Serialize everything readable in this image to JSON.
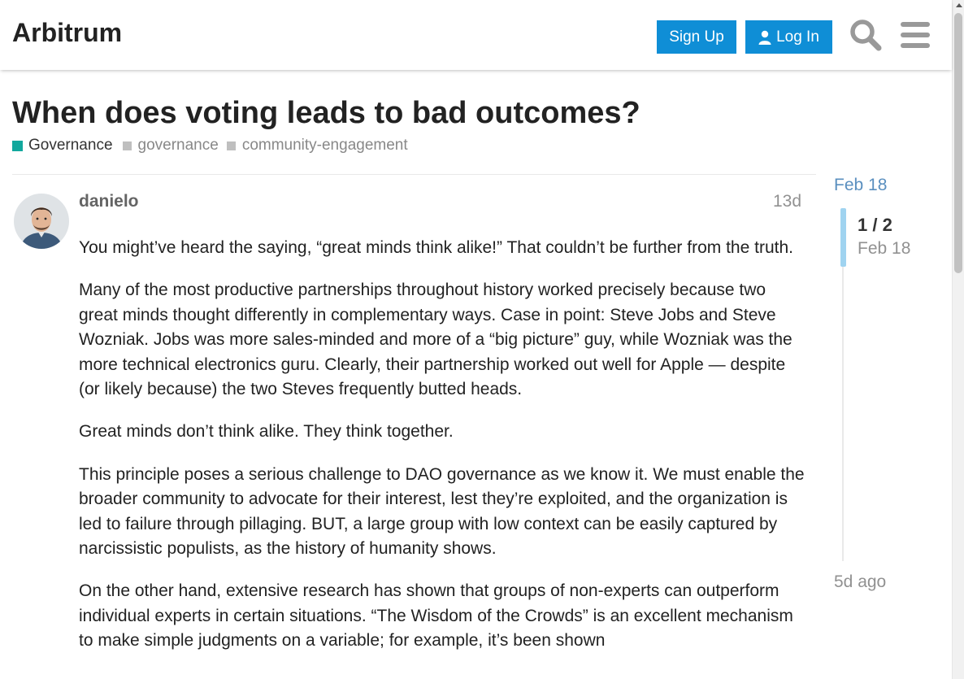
{
  "header": {
    "site_title": "Arbitrum",
    "signup_label": "Sign Up",
    "login_label": "Log In"
  },
  "topic": {
    "title": "When does voting leads to bad outcomes?",
    "category": "Governance",
    "tags": [
      "governance",
      "community-engagement"
    ]
  },
  "post": {
    "username": "danielo",
    "age": "13d",
    "paragraphs": [
      "You might’ve heard the saying, “great minds think alike!” That couldn’t be further from the truth.",
      "Many of the most productive partnerships throughout history worked precisely because two great minds thought differently in complementary ways. Case in point: Steve Jobs and Steve Wozniak. Jobs was more sales-minded and more of a “big picture” guy, while Wozniak was the more technical electronics guru. Clearly, their partnership worked out well for Apple — despite (or likely because) the two Steves frequently butted heads.",
      "Great minds don’t think alike. They think together.",
      "This principle poses a serious challenge to DAO governance as we know it. We must enable the broader community to advocate for their interest, lest they’re exploited, and the organization is led to failure through pillaging. BUT, a large group with low context can be easily captured by narcissistic populists, as the history of humanity shows.",
      "On the other hand, extensive research has shown that groups of non-experts can outperform individual experts in certain situations. “The Wisdom of the Crowds” is an excellent mechanism to make simple judgments on a variable; for example, it’s been shown"
    ]
  },
  "timeline": {
    "start": "Feb 18",
    "count": "1 / 2",
    "current_date": "Feb 18",
    "end": "5d ago"
  },
  "colors": {
    "accent": "#0f8ed6",
    "category": "#12a89d",
    "timeline_handle": "#9fd3f0"
  },
  "icons": [
    "search-icon",
    "hamburger-menu-icon",
    "user-icon"
  ]
}
